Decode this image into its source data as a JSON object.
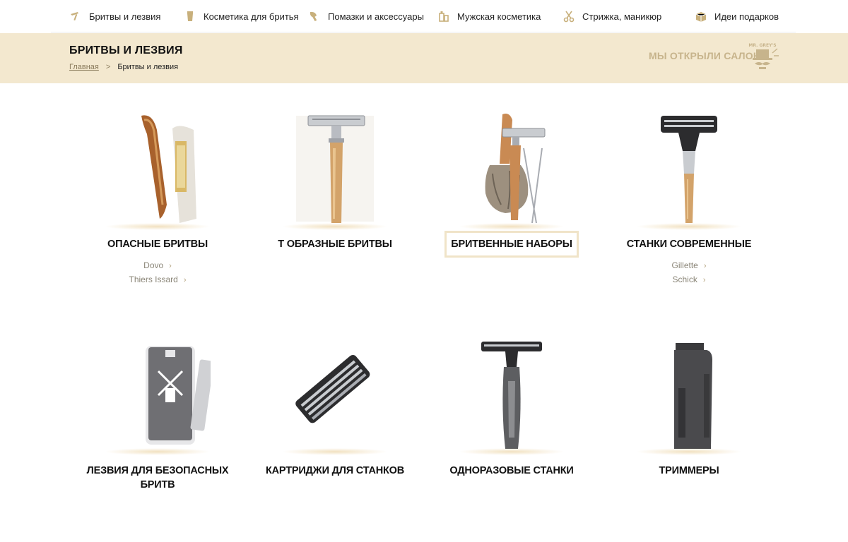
{
  "nav": {
    "items": [
      {
        "label": "Бритвы и лезвия",
        "icon": "razor-icon"
      },
      {
        "label": "Косметика для бритья",
        "icon": "cream-jar-icon"
      },
      {
        "label": "Помазки и аксессуары",
        "icon": "shaving-brush-icon"
      },
      {
        "label": "Мужская косметика",
        "icon": "bottles-icon"
      },
      {
        "label": "Стрижка, маникюр",
        "icon": "scissors-icon"
      },
      {
        "label": "Идеи подарков",
        "icon": "gift-box-icon"
      }
    ]
  },
  "header": {
    "title": "БРИТВЫ И ЛЕЗВИЯ",
    "breadcrumb": {
      "home": "Главная",
      "separator": ">",
      "current": "Бритвы и лезвия"
    },
    "promo": "МЫ ОТКРЫЛИ САЛОН!",
    "logo_text": "MR. GREY'S"
  },
  "categories": [
    {
      "title": "ОПАСНЫЕ БРИТВЫ",
      "links": [
        "Dovo",
        "Thiers Issard"
      ],
      "image": "straight-razor-icon"
    },
    {
      "title": "Т ОБРАЗНЫЕ БРИТВЫ",
      "links": [],
      "image": "safety-razor-icon"
    },
    {
      "title": "БРИТВЕННЫЕ НАБОРЫ",
      "links": [],
      "image": "shaving-set-icon",
      "highlighted": true
    },
    {
      "title": "СТАНКИ СОВРЕМЕННЫЕ",
      "links": [
        "Gillette",
        "Schick"
      ],
      "image": "cartridge-razor-icon"
    },
    {
      "title_line1": "ЛЕЗВИЯ ДЛЯ БЕЗОПАСНЫХ",
      "title_line2": "БРИТВ",
      "links": [],
      "image": "razor-blades-icon"
    },
    {
      "title": "КАРТРИДЖИ ДЛЯ СТАНКОВ",
      "links": [],
      "image": "cartridge-icon"
    },
    {
      "title": "ОДНОРАЗОВЫЕ СТАНКИ",
      "links": [],
      "image": "disposable-razor-icon"
    },
    {
      "title": "ТРИММЕРЫ",
      "links": [],
      "image": "trimmer-icon"
    }
  ],
  "colors": {
    "band": "#f3e8cf",
    "accent": "#c7b48c",
    "highlight_border": "#f0e4c8"
  }
}
